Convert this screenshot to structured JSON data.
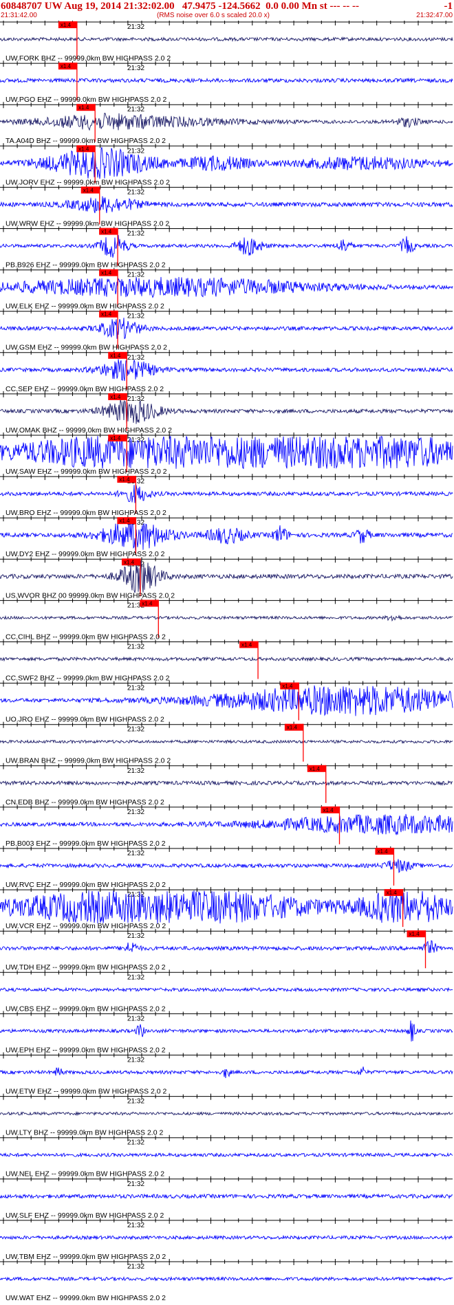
{
  "header": {
    "title": "60848707 UW Aug 19, 2014 21:32:02.00   47.9475 -124.5662  0.0 0.00 Mn st --- -- --",
    "trailing": "-1",
    "start_time": "21:31:42.00",
    "note": "(RMS noise over 6.0 s scaled 20.0 x)",
    "end_time": "21:32:47.00"
  },
  "colors": {
    "trace_blue": "#0000ff",
    "trace_navy": "#1a1a66",
    "pick": "#ff0000",
    "text": "#000000",
    "header": "#cc0000"
  },
  "chart_data": {
    "type": "line",
    "title": "60848707 UW Aug 19, 2014 21:32:02.00   47.9475 -124.5662  0.0 0.00 Mn st --- -- --",
    "x_axis": {
      "start": "21:31:42.00",
      "end": "21:32:47.00",
      "minute_label": "21:32"
    },
    "pick_label": "x1.4",
    "stations": [
      {
        "label": "UW.FORK BHZ -- 99999.0km BW  HIGHPASS  2.0  2",
        "color": "#1a1a66",
        "pick": 0.17,
        "amp": 0.35,
        "events": []
      },
      {
        "label": "UW.PGO EHZ -- 99999.0km BW  HIGHPASS  2.0  2",
        "color": "#0000ff",
        "pick": 0.17,
        "amp": 0.4,
        "events": []
      },
      {
        "label": "TA.A04D BHZ -- 99999.0km BW  HIGHPASS  2.0  2",
        "color": "#1a1a66",
        "pick": 0.21,
        "amp": 0.35,
        "events": [
          [
            0.22,
            0.6,
            0.08
          ],
          [
            0.3,
            0.8,
            0.15
          ],
          [
            0.9,
            0.7,
            0.02
          ]
        ]
      },
      {
        "label": "UW.JORV EHZ -- 99999.0km BW  HIGHPASS  2.0  2",
        "color": "#0000ff",
        "pick": 0.21,
        "amp": 0.45,
        "events": [
          [
            0.22,
            2.0,
            0.08
          ],
          [
            0.48,
            0.9,
            0.05
          ],
          [
            0.8,
            0.8,
            0.1
          ]
        ]
      },
      {
        "label": "UW.WRW EHZ -- 99999.0km BW  HIGHPASS  2.0  2",
        "color": "#0000ff",
        "pick": 0.22,
        "amp": 0.45,
        "events": [
          [
            0.23,
            1.0,
            0.05
          ]
        ]
      },
      {
        "label": "PB.B926 EHZ -- 99999.0km BW  HIGHPASS  2.0  2",
        "color": "#0000ff",
        "pick": 0.26,
        "amp": 0.35,
        "events": [
          [
            0.25,
            2.0,
            0.02
          ],
          [
            0.55,
            1.6,
            0.02
          ],
          [
            0.76,
            1.2,
            0.01
          ],
          [
            0.9,
            1.5,
            0.01
          ]
        ]
      },
      {
        "label": "UW.ELK EHZ -- 99999.0km BW  HIGHPASS  2.0  2",
        "color": "#0000ff",
        "pick": 0.26,
        "amp": 0.4,
        "events": [
          [
            0.27,
            1.2,
            0.2
          ],
          [
            0.55,
            0.6,
            0.15
          ]
        ]
      },
      {
        "label": "UW.GSM EHZ -- 99999.0km BW  HIGHPASS  2.0  2",
        "color": "#0000ff",
        "pick": 0.26,
        "amp": 0.4,
        "events": [
          [
            0.265,
            1.5,
            0.03
          ]
        ]
      },
      {
        "label": "CC.SEP EHZ -- 99999.0km BW  HIGHPASS  2.0  2",
        "color": "#0000ff",
        "pick": 0.28,
        "amp": 0.4,
        "events": [
          [
            0.28,
            1.6,
            0.04
          ]
        ]
      },
      {
        "label": "UW.OMAK BHZ -- 99999.0km BW  HIGHPASS  2.0  2",
        "color": "#1a1a66",
        "pick": 0.28,
        "amp": 0.4,
        "events": [
          [
            0.29,
            1.9,
            0.04
          ]
        ]
      },
      {
        "label": "UW.SAW EHZ -- 99999.0km BW  HIGHPASS  2.0  2",
        "color": "#0000ff",
        "pick": 0.28,
        "amp": 0.6,
        "events": [
          [
            0.3,
            1.6,
            0.2
          ],
          [
            0.6,
            1.3,
            0.2
          ],
          [
            0.9,
            1.2,
            0.1
          ]
        ]
      },
      {
        "label": "UW.BRO EHZ -- 99999.0km BW  HIGHPASS  2.0  2",
        "color": "#0000ff",
        "pick": 0.3,
        "amp": 0.4,
        "events": [
          [
            0.3,
            1.3,
            0.02
          ]
        ]
      },
      {
        "label": "UW.DY2 EHZ -- 99999.0km BW  HIGHPASS  2.0  2",
        "color": "#0000ff",
        "pick": 0.3,
        "amp": 0.45,
        "events": [
          [
            0.3,
            2.0,
            0.05
          ],
          [
            0.5,
            1.0,
            0.03
          ],
          [
            0.62,
            1.2,
            0.01
          ],
          [
            0.8,
            1.0,
            0.01
          ]
        ]
      },
      {
        "label": "US.WVOR BHZ 00 99999.0km BW  HIGHPASS  2.0  2",
        "color": "#1a1a66",
        "pick": 0.31,
        "amp": 0.45,
        "events": [
          [
            0.31,
            2.2,
            0.03
          ]
        ]
      },
      {
        "label": "CC.CIHL BHZ -- 99999.0km BW  HIGHPASS  2.0  2",
        "color": "#1a1a66",
        "pick": 0.35,
        "amp": 0.3,
        "events": [
          [
            0.87,
            0.6,
            0.01
          ]
        ]
      },
      {
        "label": "CC.SWF2 BHZ -- 99999.0km BW  HIGHPASS  2.0  2",
        "color": "#1a1a66",
        "pick": 0.57,
        "amp": 0.35,
        "events": []
      },
      {
        "label": "UO.JRO EHZ -- 99999.0km BW  HIGHPASS  2.0  2",
        "color": "#0000ff",
        "pick": 0.66,
        "amp": 0.4,
        "events": [
          [
            0.77,
            2.3,
            0.2
          ]
        ]
      },
      {
        "label": "UW.BRAN BHZ -- 99999.0km BW  HIGHPASS  2.0  2",
        "color": "#1a1a66",
        "pick": 0.67,
        "amp": 0.3,
        "events": []
      },
      {
        "label": "CN.EDB BHZ -- 99999.0km BW  HIGHPASS  2.0  2",
        "color": "#1a1a66",
        "pick": 0.72,
        "amp": 0.4,
        "events": []
      },
      {
        "label": "PB.B003 EHZ -- 99999.0km BW  HIGHPASS  2.0  2",
        "color": "#0000ff",
        "pick": 0.75,
        "amp": 0.4,
        "events": [
          [
            0.86,
            1.4,
            0.18
          ]
        ]
      },
      {
        "label": "UW.RVC EHZ -- 99999.0km BW  HIGHPASS  2.0  2",
        "color": "#0000ff",
        "pick": 0.87,
        "amp": 0.4,
        "events": [
          [
            0.88,
            0.9,
            0.02
          ]
        ]
      },
      {
        "label": "UW.VCR EHZ -- 99999.0km BW  HIGHPASS  2.0  2",
        "color": "#0000ff",
        "pick": 0.89,
        "amp": 0.6,
        "events": [
          [
            0.35,
            2.0,
            0.22
          ],
          [
            0.9,
            2.0,
            0.06
          ]
        ]
      },
      {
        "label": "UW.TDH EHZ -- 99999.0km BW  HIGHPASS  2.0  2",
        "color": "#0000ff",
        "pick": 0.94,
        "amp": 0.4,
        "events": [
          [
            0.29,
            0.9,
            0.01
          ],
          [
            0.95,
            1.0,
            0.01
          ]
        ]
      },
      {
        "label": "UW.CBS EHZ -- 99999.0km BW  HIGHPASS  2.0  2",
        "color": "#0000ff",
        "pick": null,
        "amp": 0.35,
        "events": []
      },
      {
        "label": "UW.EPH EHZ -- 99999.0km BW  HIGHPASS  2.0  2",
        "color": "#0000ff",
        "pick": null,
        "amp": 0.35,
        "events": [
          [
            0.31,
            1.4,
            0.005
          ],
          [
            0.91,
            2.0,
            0.005
          ]
        ]
      },
      {
        "label": "UW.ETW EHZ -- 99999.0km BW  HIGHPASS  2.0  2",
        "color": "#0000ff",
        "pick": null,
        "amp": 0.35,
        "events": [
          [
            0.13,
            1.0,
            0.005
          ],
          [
            0.5,
            1.0,
            0.005
          ],
          [
            0.8,
            0.9,
            0.005
          ]
        ]
      },
      {
        "label": "UW.LTY BHZ -- 99999.0km BW  HIGHPASS  2.0  2",
        "color": "#1a1a66",
        "pick": null,
        "amp": 0.3,
        "events": []
      },
      {
        "label": "UW.NEL EHZ -- 99999.0km BW  HIGHPASS  2.0  2",
        "color": "#0000ff",
        "pick": null,
        "amp": 0.35,
        "events": []
      },
      {
        "label": "UW.SLF EHZ -- 99999.0km BW  HIGHPASS  2.0  2",
        "color": "#0000ff",
        "pick": null,
        "amp": 0.4,
        "events": []
      },
      {
        "label": "UW.TBM EHZ -- 99999.0km BW  HIGHPASS  2.0  2",
        "color": "#0000ff",
        "pick": null,
        "amp": 0.35,
        "events": []
      },
      {
        "label": "UW.WAT EHZ -- 99999.0km BW  HIGHPASS  2.0  2",
        "color": "#0000ff",
        "pick": null,
        "amp": 0.35,
        "events": []
      }
    ]
  }
}
